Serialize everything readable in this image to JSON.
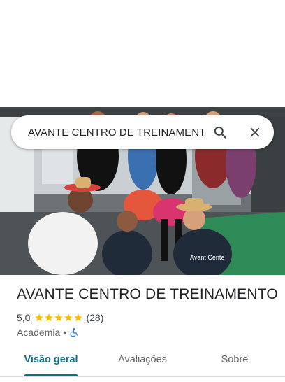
{
  "search": {
    "value": "AVANTE CENTRO DE TREINAMENTO"
  },
  "place": {
    "name": "AVANTE CENTRO DE TREINAMENTO",
    "rating": "5,0",
    "rating_value": 5,
    "review_count": "(28)",
    "category": "Academia",
    "separator": "•",
    "accessibility_icon": "wheelchair-icon"
  },
  "photo": {
    "shirt_text": "Avant Cente"
  },
  "tabs": [
    {
      "label": "Visão geral",
      "active": true
    },
    {
      "label": "Avaliações",
      "active": false
    },
    {
      "label": "Sobre",
      "active": false
    }
  ],
  "colors": {
    "accent": "#0b7285",
    "star": "#fbbc04",
    "accessibility": "#1a73e8"
  }
}
